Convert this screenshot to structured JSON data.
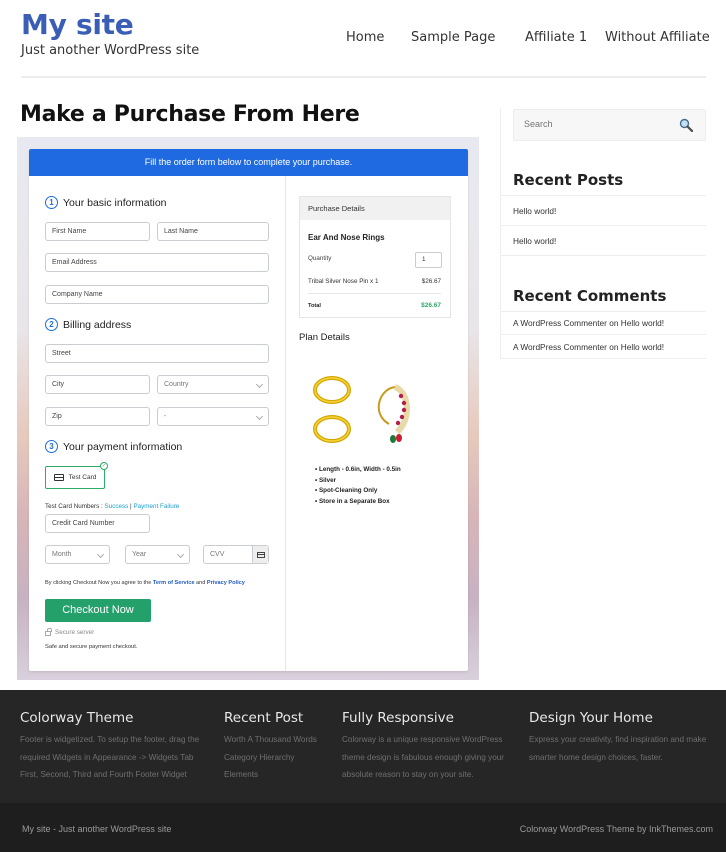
{
  "header": {
    "site_title": "My site",
    "tagline": "Just another WordPress site",
    "nav": [
      {
        "label": "Home"
      },
      {
        "label": "Sample Page"
      },
      {
        "label": "Affiliate 1"
      },
      {
        "label": "Without Affiliate"
      }
    ]
  },
  "main": {
    "page_title": "Make a Purchase From Here",
    "order_form": {
      "banner": "Fill the order form below to complete your purchase.",
      "steps": [
        {
          "num": "1",
          "label": "Your basic information"
        },
        {
          "num": "2",
          "label": "Billing address"
        },
        {
          "num": "3",
          "label": "Your payment information"
        }
      ],
      "fields": {
        "first_name": "First Name",
        "last_name": "Last Name",
        "email": "Email Address",
        "company": "Company Name",
        "street": "Street",
        "city": "City",
        "country": "Country",
        "zip": "Zip",
        "state": "-",
        "card_number": "Credit Card Number",
        "month": "Month",
        "year": "Year",
        "cvv": "CVV"
      },
      "payment_option": "Test Card",
      "test_numbers": {
        "label": "Test Card Numbers : ",
        "success": "Success",
        "separator": " | ",
        "failure": "Payment Failure"
      },
      "agreement": {
        "prefix": "By clicking Checkout Now you agree to the ",
        "terms": "Term of Service",
        "and": " and ",
        "privacy": "Privacy Policy"
      },
      "checkout_button": "Checkout Now",
      "secure_server": "Secure server",
      "safe_text": "Safe and secure payment checkout."
    },
    "purchase_details": {
      "heading": "Purchase Details",
      "product": "Ear And Nose Rings",
      "quantity_label": "Quantity",
      "quantity": "1",
      "line_item": "Tribal Silver Nose Pin x 1",
      "line_price": "$26.67",
      "total_label": "Total",
      "total_price": "$26.67"
    },
    "plan": {
      "title": "Plan Details",
      "image": "gold-ear-and-nose-rings",
      "features": [
        "Length - 0.6in, Width - 0.5in",
        "Silver",
        "Spot-Cleaning Only",
        "Store in a Separate Box"
      ]
    }
  },
  "sidebar": {
    "search_placeholder": "Search",
    "recent_posts": {
      "title": "Recent Posts",
      "items": [
        "Hello world!",
        "Hello world!"
      ]
    },
    "recent_comments": {
      "title": "Recent Comments",
      "items": [
        "A WordPress Commenter on Hello world!",
        "A WordPress Commenter on Hello world!"
      ]
    }
  },
  "footer": {
    "columns": [
      {
        "title": "Colorway Theme",
        "lines": [
          "Footer is widgetized. To setup the footer, drag the",
          "required Widgets in Appearance -> Widgets Tab",
          "First, Second, Third and Fourth Footer Widget"
        ]
      },
      {
        "title": "Recent Post",
        "lines": [
          "Worth A Thousand Words",
          "Category Hierarchy",
          "Elements"
        ]
      },
      {
        "title": "Fully Responsive",
        "lines": [
          "Colorway is a unique responsive WordPress",
          "theme design is fabulous enough giving your",
          "absolute reason to stay on your site."
        ]
      },
      {
        "title": "Design Your Home",
        "lines": [
          "Express your creativity, find inspiration and make",
          "smarter home design choices, faster."
        ]
      }
    ],
    "bottom_left": "My site - Just another WordPress site",
    "bottom_right": "Colorway WordPress Theme by InkThemes.com"
  },
  "colors": {
    "brand_blue": "#3a5db5",
    "banner_blue": "#1f6ae0",
    "checkout_green": "#24a06b",
    "total_green": "#2eaa6a",
    "footer_bg": "#262626"
  }
}
